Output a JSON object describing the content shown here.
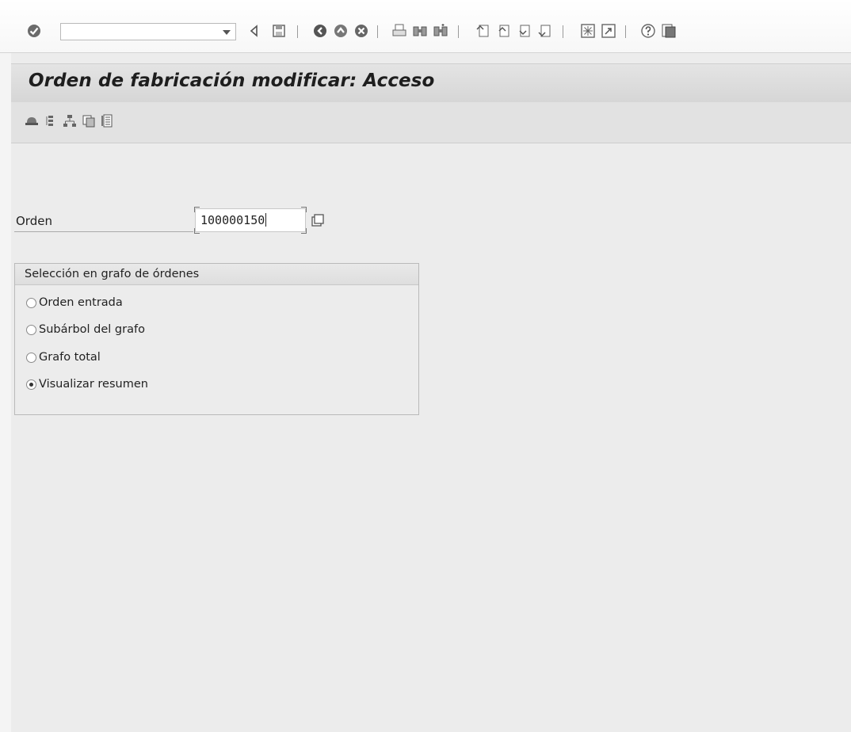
{
  "toolbar": {
    "command_field_value": "",
    "buttons": [
      {
        "name": "enter-icon",
        "glyph": "check"
      },
      {
        "name": "back-icon",
        "glyph": "triangle-left"
      },
      {
        "name": "save-icon",
        "glyph": "floppy"
      },
      {
        "name": "back-arrow-icon",
        "glyph": "circle-left"
      },
      {
        "name": "exit-icon",
        "glyph": "circle-up"
      },
      {
        "name": "cancel-icon",
        "glyph": "circle-x"
      },
      {
        "name": "print-icon",
        "glyph": "printer"
      },
      {
        "name": "find-icon",
        "glyph": "binoculars"
      },
      {
        "name": "find-next-icon",
        "glyph": "binoculars-plus"
      },
      {
        "name": "first-page-icon",
        "glyph": "page-first"
      },
      {
        "name": "previous-page-icon",
        "glyph": "page-prev"
      },
      {
        "name": "next-page-icon",
        "glyph": "page-next"
      },
      {
        "name": "last-page-icon",
        "glyph": "page-last"
      },
      {
        "name": "new-session-icon",
        "glyph": "window-new"
      },
      {
        "name": "shortcut-icon",
        "glyph": "window-link"
      },
      {
        "name": "help-icon",
        "glyph": "question"
      },
      {
        "name": "layout-menu-icon",
        "glyph": "monitor"
      }
    ]
  },
  "title": "Orden de fabricación modificar: Acceso",
  "app_toolbar": {
    "buttons": [
      {
        "name": "hat-icon"
      },
      {
        "name": "hierarchy-vertical-icon"
      },
      {
        "name": "network-graph-icon"
      },
      {
        "name": "copy-icon"
      },
      {
        "name": "detail-list-icon"
      }
    ]
  },
  "form": {
    "order_label": "Orden",
    "order_value": "100000150"
  },
  "group": {
    "title": "Selección en grafo de órdenes",
    "options": [
      {
        "label": "Orden entrada",
        "checked": false
      },
      {
        "label": "Subárbol del grafo",
        "checked": false
      },
      {
        "label": "Grafo total",
        "checked": false
      },
      {
        "label": "Visualizar resumen",
        "checked": true
      }
    ]
  },
  "colors": {
    "background": "#ececec",
    "title_bar": "#dcdcdc",
    "text": "#222222"
  }
}
